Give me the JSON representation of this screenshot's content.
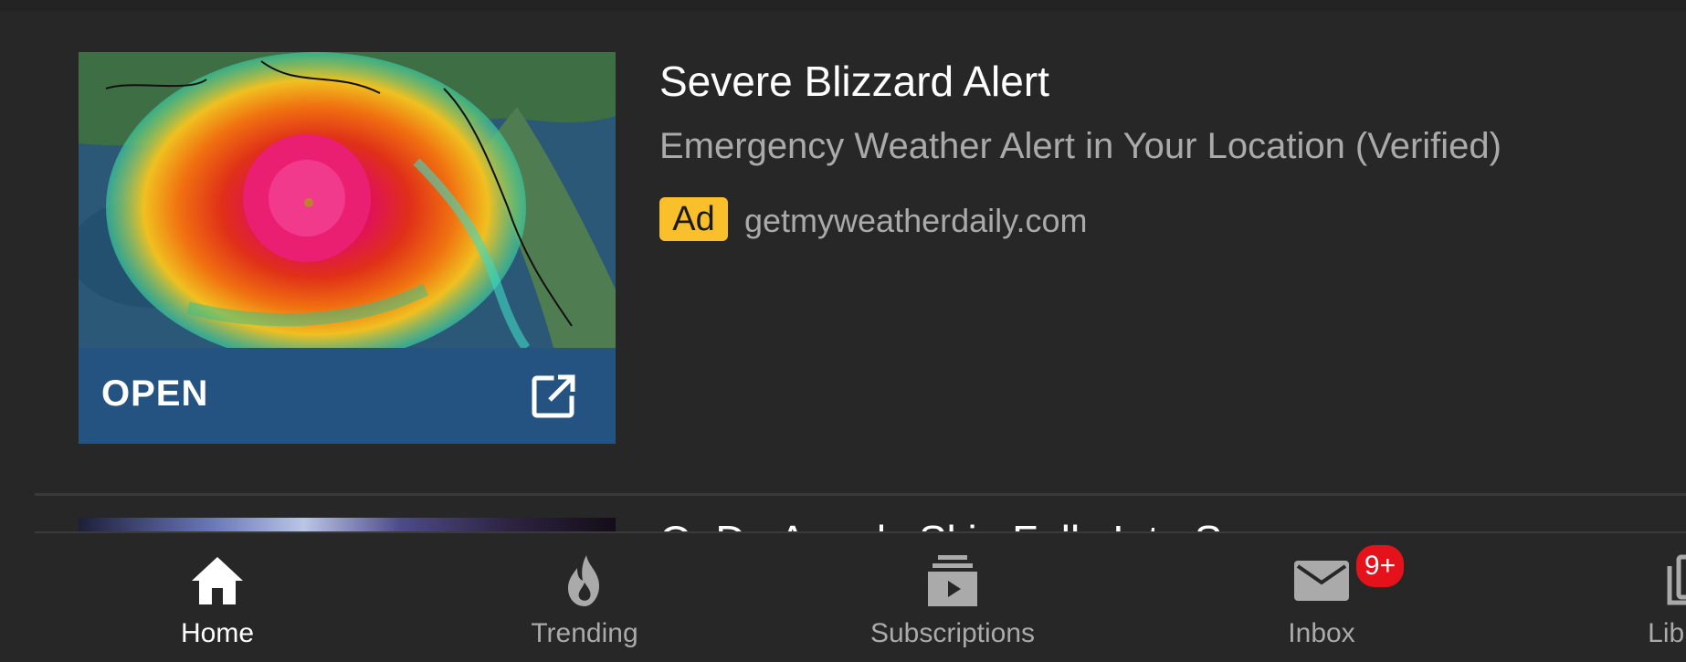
{
  "ad": {
    "title": "Severe Blizzard Alert",
    "subtitle": "Emergency Weather Alert in Your Location (Verified)",
    "badge": "Ad",
    "domain": "getmyweatherdaily.com",
    "cta_label": "OPEN",
    "cta_icon": "open-in-new-icon"
  },
  "next_video": {
    "title": "Q: Do Angels Skip Falls Into S..."
  },
  "nav": {
    "items": [
      {
        "label": "Home",
        "icon": "home-icon",
        "active": true
      },
      {
        "label": "Trending",
        "icon": "flame-icon"
      },
      {
        "label": "Subscriptions",
        "icon": "subscriptions-icon"
      },
      {
        "label": "Inbox",
        "icon": "mail-icon",
        "badge": "9+"
      },
      {
        "label": "Library",
        "icon": "library-icon"
      }
    ]
  },
  "colors": {
    "background": "#272727",
    "accent_blue": "#245381",
    "ad_badge": "#f9c02b",
    "notification_red": "#e5121b"
  }
}
